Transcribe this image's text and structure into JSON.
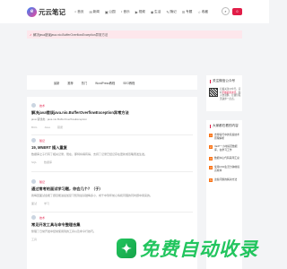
{
  "header": {
    "logo_mark": "e",
    "logo_text": "元云笔记",
    "nav": [
      {
        "icon": "⌂",
        "label": "首页"
      },
      {
        "icon": "✉",
        "label": "新闻"
      },
      {
        "icon": "▣",
        "label": "公园"
      },
      {
        "icon": "♪",
        "label": "音乐"
      },
      {
        "icon": "▶",
        "label": "视频"
      },
      {
        "icon": "◉",
        "label": "生活"
      },
      {
        "icon": "✎",
        "label": "随记"
      },
      {
        "icon": "☰",
        "label": "专题"
      },
      {
        "icon": "☆",
        "label": "收藏"
      }
    ],
    "search_icon": "⌕",
    "login_icon": "☺"
  },
  "notice": {
    "icon": "♪",
    "text": "解决java错误java.nio.BufferOverflowException异常方法"
  },
  "tags": [
    "最新",
    "推荐",
    "热门",
    "WordPress教程",
    "SEO教程"
  ],
  "posts": [
    {
      "category": "技术",
      "title": "解决java错误java.nio.BufferOverflowException异常方法",
      "desc": "java 错误类 : java.nio.BufferOverflowException",
      "stats": [
        "BUG",
        "Java",
        "错误"
      ]
    },
    {
      "category": "随记",
      "title": "19, MNERT 插入重复",
      "desc": "数据库之子行有了相关记录，既在，那特将填有得，支持了记录已经记存在更新或忽略而发生发。",
      "stats": [
        "SQL",
        "数据库"
      ]
    },
    {
      "category": "随记",
      "title": "通过常考的面试学习题，你会几个？（于）",
      "desc": "我每回面试会能了题目能进最加复习知到最基础每多小，成千中到年前心情和同理的同时题中用来的。",
      "stats": [
        "面试",
        "学习"
      ]
    },
    {
      "category": "技术",
      "title": "常见开发工具与命令整理合集",
      "desc": "整理了日常开发中经常使用到的工具以及命令行技巧。",
      "stats": [
        "工具"
      ]
    }
  ],
  "sidebar": {
    "wechat_title": "关注微信公众号",
    "qr_text_1": "扫描关注公众号，实时",
    "qr_text_hl": "掌握最新资讯",
    "qr_text_2": "，加入交流群，让我们每天进步一点点。",
    "hot_title": "大家都在看的内容",
    "hot": [
      "去博客行中的某些技术原理解析",
      "VarP一小时搞定数据库，在学习工作",
      "数据中心代码来年汇总",
      "使用CSS生活分钟前提高效率",
      "这些问题的解决方法"
    ]
  },
  "watermark": {
    "logo": "✦",
    "text": "免费自动收录"
  }
}
